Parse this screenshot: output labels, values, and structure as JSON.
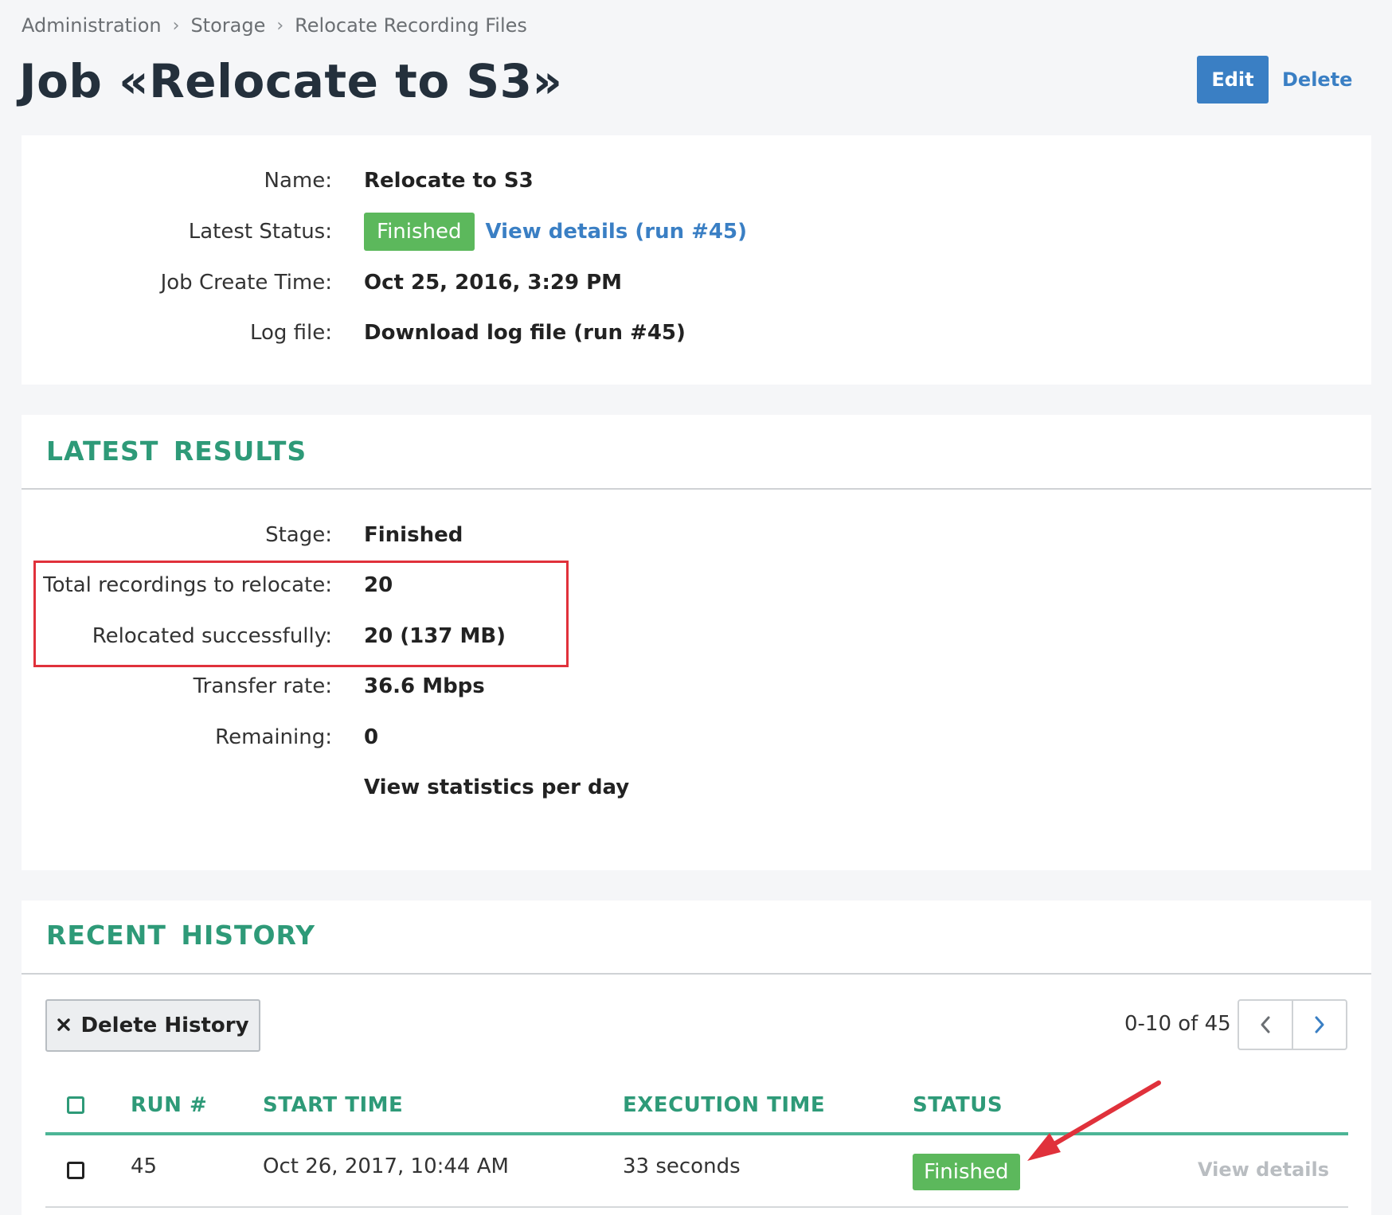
{
  "breadcrumb": [
    "Administration",
    "Storage",
    "Relocate Recording Files"
  ],
  "page_title": "Job «Relocate to S3»",
  "actions": {
    "edit": "Edit",
    "delete": "Delete"
  },
  "job_info": {
    "name_label": "Name:",
    "name_value": "Relocate to S3",
    "status_label": "Latest Status:",
    "status_badge": "Finished",
    "status_link": "View details (run #45)",
    "create_label": "Job Create Time:",
    "create_value": "Oct 25, 2016, 3:29 PM",
    "log_label": "Log file:",
    "log_link": "Download log file (run #45)"
  },
  "latest_results": {
    "title": "LATEST RESULTS",
    "stage_label": "Stage:",
    "stage_value": "Finished",
    "total_label": "Total recordings to relocate:",
    "total_value": "20",
    "relocated_label": "Relocated successfully:",
    "relocated_value": "20 (137 MB)",
    "rate_label": "Transfer rate:",
    "rate_value": "36.6 Mbps",
    "remaining_label": "Remaining:",
    "remaining_value": "0",
    "stats_link": "View statistics per day"
  },
  "recent_history": {
    "title": "RECENT HISTORY",
    "delete_history": "Delete History",
    "pager_text": "0-10 of 45",
    "columns": [
      "RUN #",
      "START TIME",
      "EXECUTION TIME",
      "STATUS"
    ],
    "rows": [
      {
        "run": "45",
        "start": "Oct 26, 2017, 10:44 AM",
        "exec": "33 seconds",
        "status": "Finished",
        "details": "View details"
      }
    ]
  },
  "colors": {
    "accent": "#3a7fc4",
    "section": "#2e9a78",
    "success": "#5cb85c",
    "annotation": "#e0313b"
  }
}
